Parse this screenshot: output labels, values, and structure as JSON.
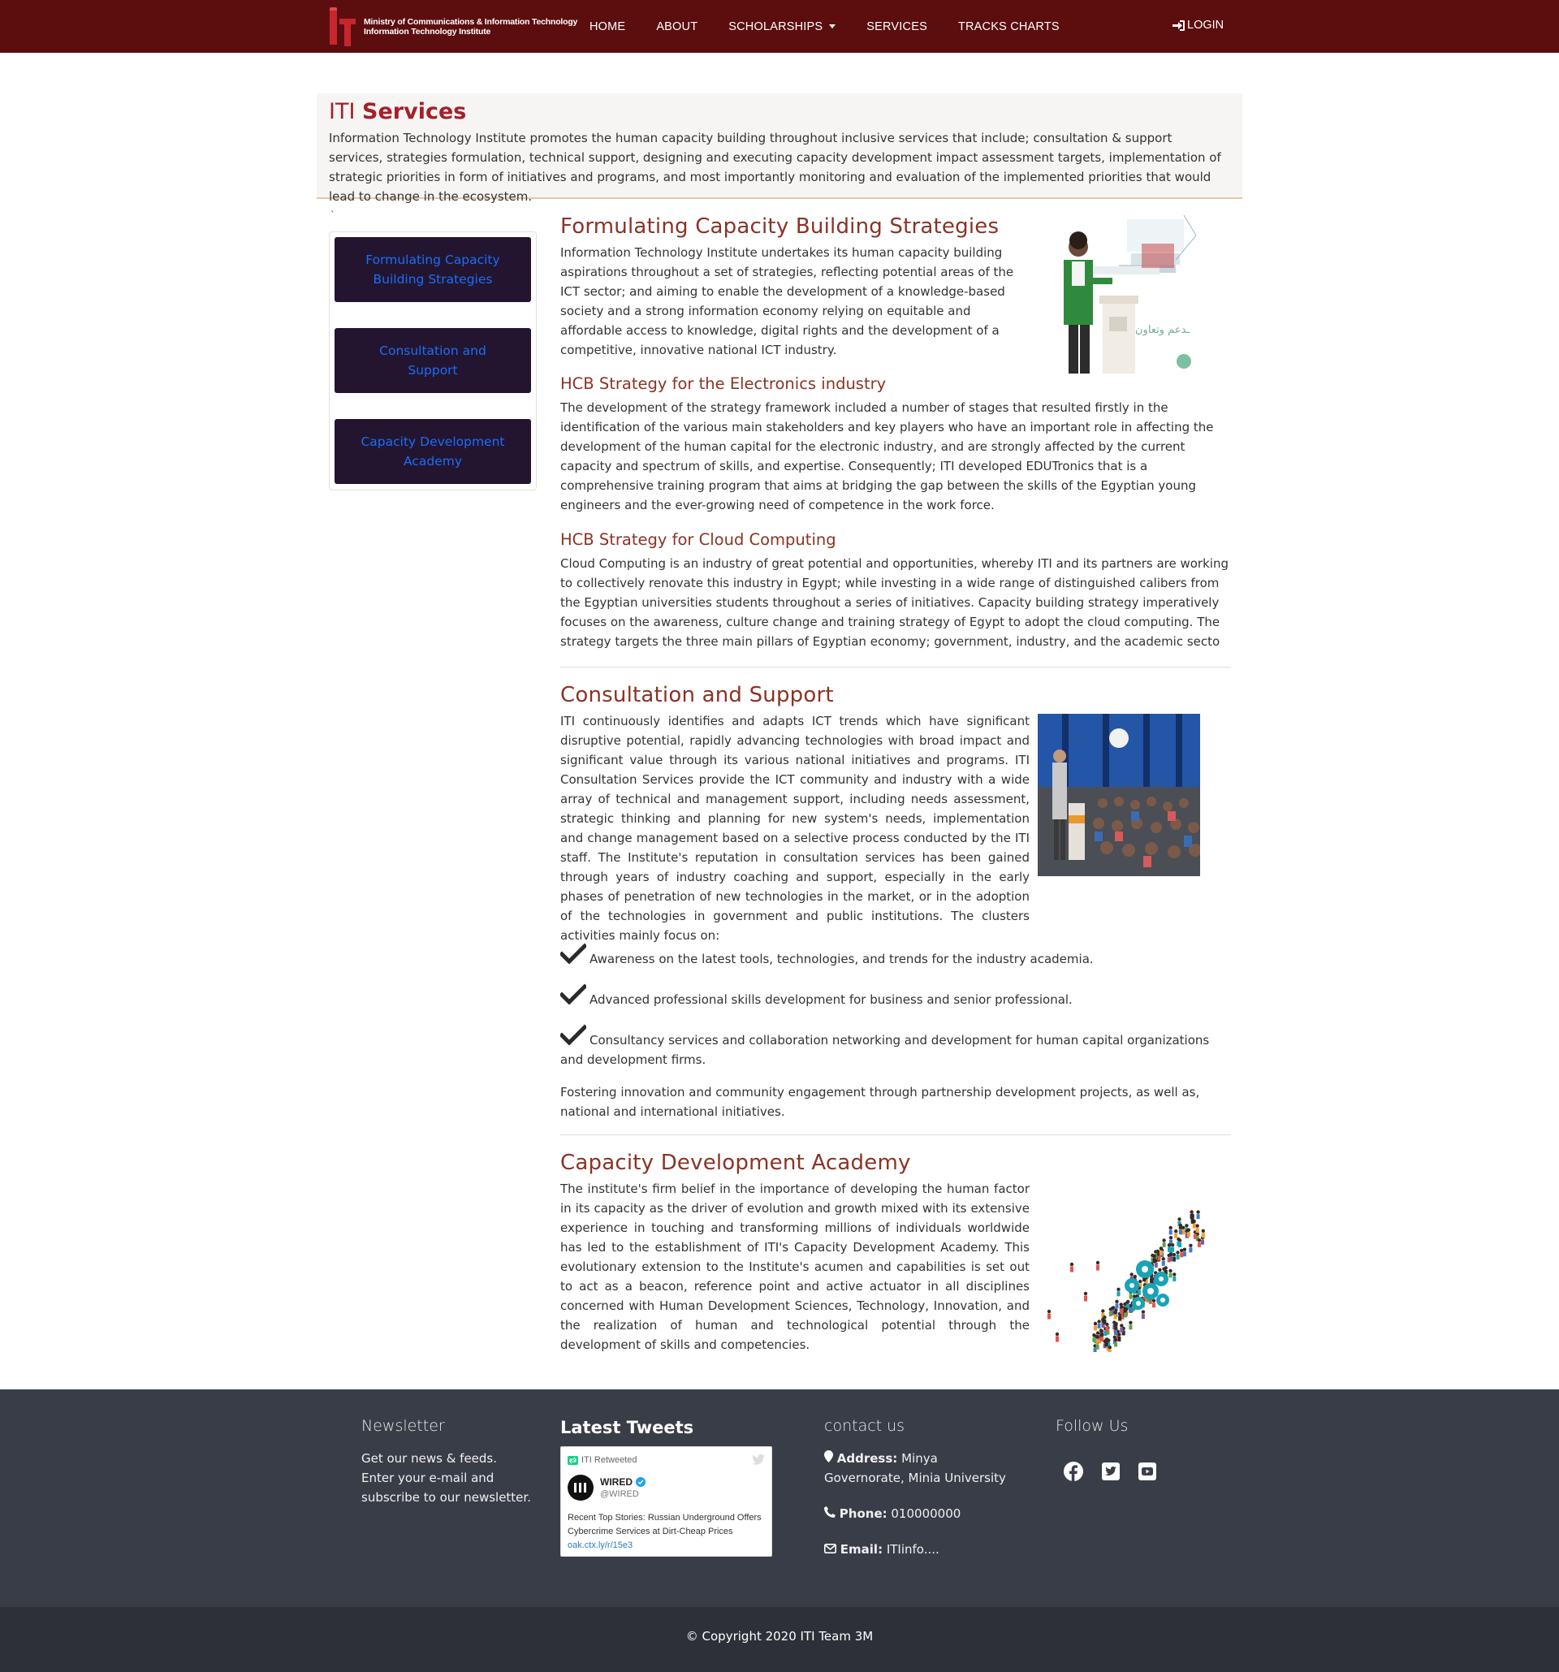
{
  "navbar": {
    "brand_line1": "Ministry of Communications & Information Technology",
    "brand_line2": "Information Technology Institute",
    "items": [
      "HOME",
      "ABOUT",
      "SCHOLARSHIPS",
      "SERVICES",
      "TRACKS CHARTS"
    ],
    "login": "LOGIN"
  },
  "intro": {
    "title_part1": "ITI",
    "title_part2": "Services",
    "text": "Information Technology Institute promotes the human capacity building throughout inclusive services that include; consultation & support services, strategies formulation, technical support, designing and executing capacity development impact assessment targets, implementation of strategic priorities in form of initiatives and programs, and most importantly monitoring and evaluation of the implemented priorities that would lead to change in the ecosystem."
  },
  "stray_mark": "`",
  "sidebar": {
    "items": [
      "Formulating Capacity Building Strategies",
      "Consultation and Support",
      "Capacity Development Academy"
    ]
  },
  "sections": {
    "formulating": {
      "title": "Formulating Capacity Building Strategies",
      "text": "Information Technology Institute undertakes its human capacity building aspirations throughout a set of strategies, reflecting potential areas of the ICT sector; and aiming to enable the development of a knowledge-based society and a strong information economy relying on equitable and affordable access to knowledge, digital rights and the development of a competitive, innovative national ICT industry.",
      "sub1_title": "HCB Strategy for the Electronics industry",
      "sub1_text": "The development of the strategy framework included a number of stages that resulted firstly in the identification of the various main stakeholders and key players who have an important role in affecting the development of the human capital for the electronic industry, and are strongly affected by the current capacity and spectrum of skills, and expertise. Consequently; ITI developed EDUTronics that is a comprehensive training program that aims at bridging the gap between the skills of the Egyptian young engineers and the ever-growing need of competence in the work force.",
      "sub2_title": "HCB Strategy for Cloud Computing",
      "sub2_text": "Cloud Computing is an industry of great potential and opportunities, whereby ITI and its partners are working to collectively renovate this industry in Egypt; while investing in a wide range of distinguished calibers from the Egyptian universities students throughout a series of initiatives. Capacity building strategy imperatively focuses on the awareness, culture change and training strategy of Egypt to adopt the cloud computing. The strategy targets the three main pillars of Egyptian economy; government, industry, and the academic secto"
    },
    "consultation": {
      "title": "Consultation and Support",
      "text": "ITI continuously identifies and adapts ICT trends which have significant disruptive potential, rapidly advancing technologies with broad impact and significant value through its various national initiatives and programs. ITI Consultation Services provide the ICT community and industry with a wide array of technical and management support, including needs assessment, strategic thinking and planning for new system's needs, implementation and change management based on a selective process conducted by the ITI staff. The Institute's reputation in consultation services has been gained through years of industry coaching and support, especially in the early phases of penetration of new technologies in the market, or in the adoption of the technologies in government and public institutions. The clusters activities mainly focus on:",
      "checks": [
        "Awareness on the latest tools, technologies, and trends for the industry academia.",
        "Advanced professional skills development for business and senior professional.",
        "Consultancy services and collaboration networking and development for human capital organizations and development firms."
      ],
      "closing": "Fostering innovation and community engagement through partnership development projects, as well as, national and international initiatives."
    },
    "academy": {
      "title": "Capacity Development Academy",
      "text": "The institute's firm belief in the importance of developing the human factor in its capacity as the driver of evolution and growth mixed with its extensive experience in touching and transforming millions of individuals worldwide has led to the establishment of ITI's Capacity Development Academy. This evolutionary extension to the Institute's acumen and capabilities is set out to act as a beacon, reference point and active actuator in all disciplines concerned with Human Development Sciences, Technology, Innovation, and the realization of human and technological potential through the development of skills and competencies."
    }
  },
  "footer": {
    "newsletter_title": "Newsletter",
    "newsletter_text": "Get our news & feeds. Enter your e-mail and subscribe to our newsletter.",
    "tweets_title": "Latest Tweets",
    "tweet": {
      "retweet_label": "ITI Retweeted",
      "account_name": "WIRED",
      "handle": "@WIRED",
      "text": "Recent Top Stories: Russian Underground Offers Cybercrime Services at Dirt-Cheap Prices",
      "link": "oak.ctx.ly/r/15e3"
    },
    "contact_title": "contact us",
    "address_label": "Address:",
    "address_value": "Minya Governorate, Minia University",
    "phone_label": "Phone:",
    "phone_value": "010000000",
    "email_label": "Email:",
    "email_value": "ITIinfo....",
    "follow_title": "Follow Us",
    "social": [
      "facebook-icon",
      "twitter-icon",
      "youtube-icon"
    ]
  },
  "copyright": "© Copyright 2020 ITI Team 3M",
  "colors": {
    "navbar": "#5c0e0f",
    "heading": "#8a3325",
    "title_red": "#a4202a",
    "sidebar_button": "#231530",
    "sidebar_link": "#1a6ef7",
    "footer": "#393d47",
    "copyright_bar": "#2d3039"
  }
}
